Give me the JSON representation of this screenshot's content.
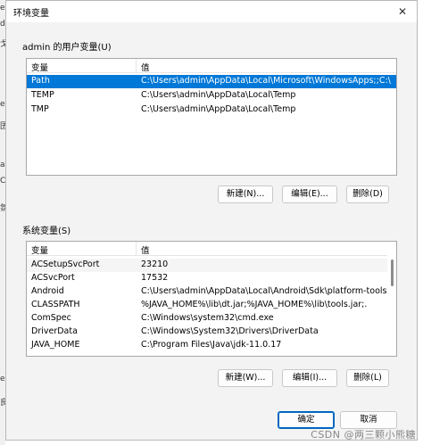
{
  "dialog": {
    "title": "环境变量",
    "close_glyph": "✕"
  },
  "background": {
    "glyphs": [
      "e",
      "d",
      "戈",
      "e",
      "囝",
      "a",
      "C",
      "氛",
      "e",
      "良"
    ]
  },
  "user_vars": {
    "label": "admin 的用户变量(U)",
    "columns": [
      "变量",
      "值"
    ],
    "rows": [
      {
        "name": "Path",
        "value": "C:\\Users\\admin\\AppData\\Local\\Microsoft\\WindowsApps;;C:\\...",
        "selected": true
      },
      {
        "name": "TEMP",
        "value": "C:\\Users\\admin\\AppData\\Local\\Temp",
        "selected": false
      },
      {
        "name": "TMP",
        "value": "C:\\Users\\admin\\AppData\\Local\\Temp",
        "selected": false
      }
    ],
    "buttons": {
      "new": "新建(N)...",
      "edit": "编辑(E)...",
      "delete": "删除(D)"
    }
  },
  "system_vars": {
    "label": "系统变量(S)",
    "columns": [
      "变量",
      "值"
    ],
    "rows": [
      {
        "name": "ACSetupSvcPort",
        "value": "23210"
      },
      {
        "name": "ACSvcPort",
        "value": "17532"
      },
      {
        "name": "Android",
        "value": "C:\\Users\\admin\\AppData\\Local\\Android\\Sdk\\platform-tools;"
      },
      {
        "name": "CLASSPATH",
        "value": "%JAVA_HOME%\\lib\\dt.jar;%JAVA_HOME%\\lib\\tools.jar;."
      },
      {
        "name": "ComSpec",
        "value": "C:\\Windows\\system32\\cmd.exe"
      },
      {
        "name": "DriverData",
        "value": "C:\\Windows\\System32\\Drivers\\DriverData"
      },
      {
        "name": "JAVA_HOME",
        "value": "C:\\Program Files\\Java\\jdk-11.0.17"
      }
    ],
    "buttons": {
      "new": "新建(W)...",
      "edit": "编辑(I)...",
      "delete": "删除(L)"
    }
  },
  "footer": {
    "ok": "确定",
    "cancel": "取消"
  },
  "watermark": "CSDN @两三颗小熊糖"
}
